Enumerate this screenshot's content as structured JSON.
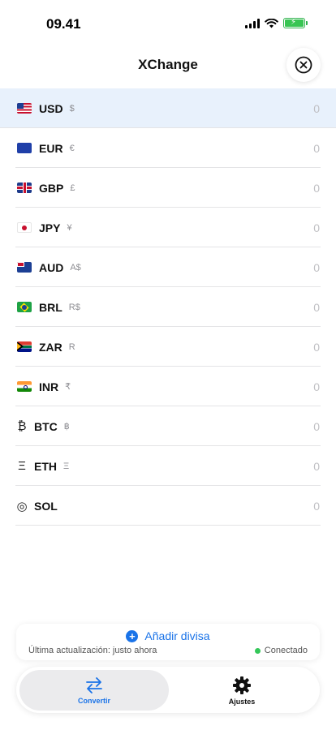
{
  "status_bar": {
    "time": "09.41"
  },
  "header": {
    "title": "XChange"
  },
  "currencies": [
    {
      "code": "USD",
      "symbol": "$",
      "value": "0",
      "icon": "us-flag-icon",
      "selected": true
    },
    {
      "code": "EUR",
      "symbol": "€",
      "value": "0",
      "icon": "eu-flag-icon"
    },
    {
      "code": "GBP",
      "symbol": "£",
      "value": "0",
      "icon": "gb-flag-icon"
    },
    {
      "code": "JPY",
      "symbol": "¥",
      "value": "0",
      "icon": "jp-flag-icon"
    },
    {
      "code": "AUD",
      "symbol": "A$",
      "value": "0",
      "icon": "au-flag-icon"
    },
    {
      "code": "BRL",
      "symbol": "R$",
      "value": "0",
      "icon": "br-flag-icon"
    },
    {
      "code": "ZAR",
      "symbol": "R",
      "value": "0",
      "icon": "za-flag-icon"
    },
    {
      "code": "INR",
      "symbol": "₹",
      "value": "0",
      "icon": "in-flag-icon"
    },
    {
      "code": "BTC",
      "symbol": "฿",
      "value": "0",
      "icon": "bitcoin-icon",
      "glyph": "₿"
    },
    {
      "code": "ETH",
      "symbol": "Ξ",
      "value": "0",
      "icon": "ethereum-icon",
      "glyph": "Ξ"
    },
    {
      "code": "SOL",
      "symbol": "",
      "value": "0",
      "icon": "solana-icon",
      "glyph": "◎"
    }
  ],
  "add_card": {
    "add_label": "Añadir divisa",
    "last_update": "Última actualización: justo ahora",
    "connection": "Conectado"
  },
  "tabs": {
    "convert": "Convertir",
    "settings": "Ajustes"
  },
  "colors": {
    "accent": "#1a73e8",
    "selected_row": "#e8f1fc",
    "connected": "#34c759"
  }
}
